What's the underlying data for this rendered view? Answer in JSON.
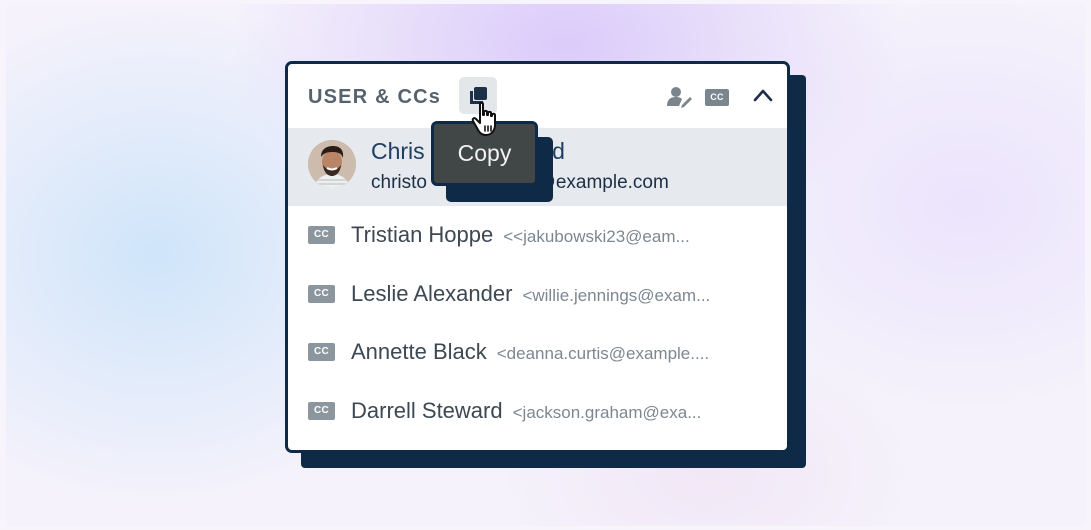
{
  "panel": {
    "title": "USER & CCs",
    "tooltip": "Copy",
    "header_icons": {
      "cc_label": "CC"
    }
  },
  "user": {
    "name": "Christopher Butterfield",
    "name_visible_left": "Chris",
    "name_visible_right": "field",
    "email_visible_left": "christo",
    "email_visible_right": "d@example.com"
  },
  "ccs": [
    {
      "badge": "CC",
      "name": "Tristian Hoppe",
      "email": "<<jakubowski23@eam..."
    },
    {
      "badge": "CC",
      "name": "Leslie Alexander",
      "email": "<willie.jennings@exam..."
    },
    {
      "badge": "CC",
      "name": "Annette Black",
      "email": "<deanna.curtis@example...."
    },
    {
      "badge": "CC",
      "name": "Darrell Steward",
      "email": "<jackson.graham@exa..."
    }
  ],
  "colors": {
    "navy": "#0e2a47",
    "row_highlight": "#e6e9ed",
    "tooltip_bg": "#414646",
    "cc_badge": "#8c969e"
  }
}
